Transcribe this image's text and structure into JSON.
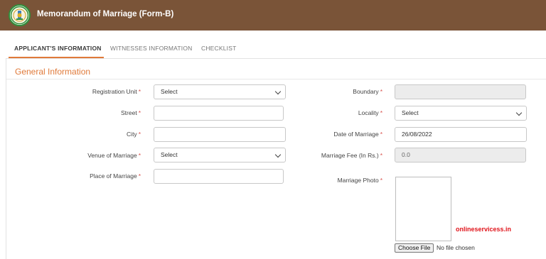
{
  "header": {
    "title": "Memorandum of Marriage (Form-B)"
  },
  "tabs": [
    {
      "label": "APPLICANT'S INFORMATION",
      "active": true
    },
    {
      "label": "WITNESSES INFORMATION",
      "active": false
    },
    {
      "label": "CHECKLIST",
      "active": false
    }
  ],
  "section": {
    "title": "General Information"
  },
  "form": {
    "registration_unit": {
      "label": "Registration Unit",
      "value": "Select"
    },
    "street": {
      "label": "Street",
      "value": ""
    },
    "city": {
      "label": "City",
      "value": ""
    },
    "venue_of_marriage": {
      "label": "Venue of Marriage",
      "value": "Select"
    },
    "place_of_marriage": {
      "label": "Place of Marriage",
      "value": ""
    },
    "boundary": {
      "label": "Boundary",
      "value": ""
    },
    "locality": {
      "label": "Locality",
      "value": "Select"
    },
    "date_of_marriage": {
      "label": "Date of Marriage",
      "value": "26/08/2022"
    },
    "marriage_fee": {
      "label": "Marriage Fee (In Rs.)",
      "value": "0.0"
    },
    "marriage_photo": {
      "label": "Marriage Photo",
      "button": "Choose File",
      "status": "No file chosen"
    },
    "required_mark": "*"
  },
  "watermark": "onlineservicess.in",
  "colors": {
    "header_bg": "#7a5438",
    "accent": "#e07a3a",
    "required": "#d9534f",
    "watermark": "#e0141b"
  }
}
